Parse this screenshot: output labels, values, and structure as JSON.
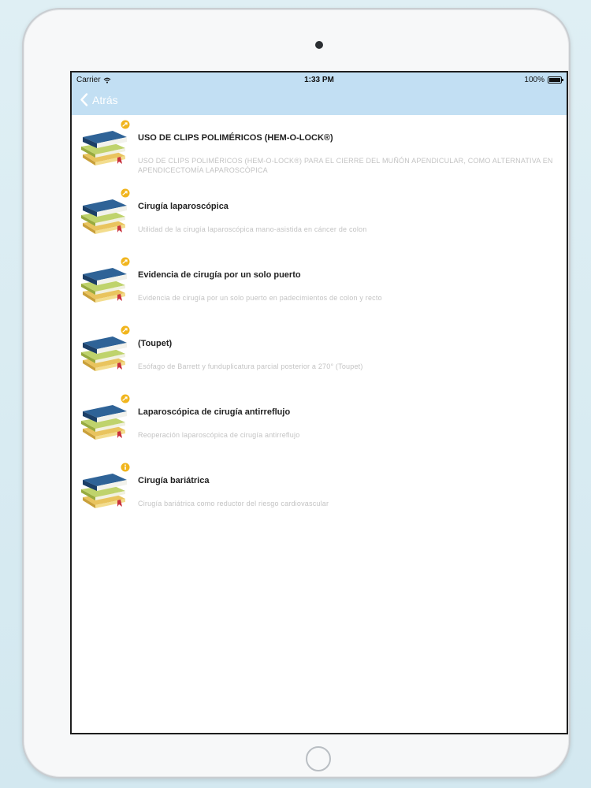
{
  "status_bar": {
    "carrier": "Carrier",
    "time": "1:33 PM",
    "battery": "100%"
  },
  "nav": {
    "back_label": "Atrás"
  },
  "items": [
    {
      "title": "USO DE CLIPS POLIMÉRICOS (HEM-O-LOCK®)",
      "subtitle": "USO DE CLIPS POLIMÉRICOS (HEM-O-LOCK®) PARA EL CIERRE DEL MUÑÓN APENDICULAR, COMO ALTERNATIVA EN APENDICECTOMÍA LAPAROSCÓPICA",
      "badge": "share"
    },
    {
      "title": "Cirugía laparoscópica",
      "subtitle": "Utilidad de la cirugía laparoscópica mano-asistida en cáncer de colon",
      "badge": "share"
    },
    {
      "title": "Evidencia de cirugía por un solo puerto",
      "subtitle": "Evidencia de cirugía por un solo puerto en padecimientos de colon y recto",
      "badge": "share"
    },
    {
      "title": "(Toupet)",
      "subtitle": "Esófago de Barrett y funduplicatura parcial posterior a 270° (Toupet)",
      "badge": "share"
    },
    {
      "title": "Laparoscópica de cirugía antirreflujo",
      "subtitle": "Reoperación laparoscópica de cirugía antirreflujo",
      "badge": "share"
    },
    {
      "title": "Cirugía bariátrica",
      "subtitle": "Cirugía bariátrica como reductor del riesgo cardiovascular",
      "badge": "info"
    }
  ],
  "colors": {
    "nav_background": "#c2dff3",
    "nav_text": "#ffffff",
    "title_text": "#222222",
    "subtitle_text": "#c3c3c3"
  }
}
